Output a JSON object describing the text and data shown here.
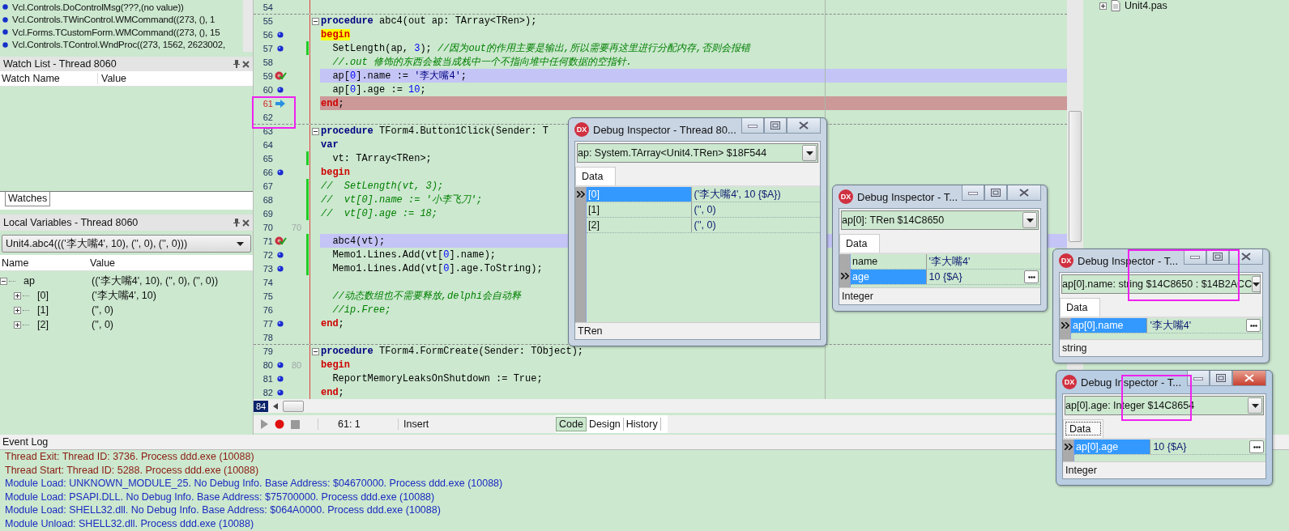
{
  "call_stack": [
    {
      "text": "Vcl.Controls.DoControlMsg(???,(no value))"
    },
    {
      "text": "Vcl.Controls.TWinControl.WMCommand((273, (), 1"
    },
    {
      "text": "Vcl.Forms.TCustomForm.WMCommand((273, (), 15"
    },
    {
      "text": "Vcl.Controls.TControl.WndProc((273, 1562, 2623002,"
    }
  ],
  "watch_list": {
    "title": "Watch List - Thread 8060",
    "columns": [
      "Watch Name",
      "Value"
    ],
    "tabs": [
      {
        "label": "Watches",
        "selected": true
      }
    ]
  },
  "local_variables": {
    "title": "Local Variables - Thread 8060",
    "frame": "Unit4.abc4((('李大嘴4', 10), ('', 0), ('', 0)))",
    "columns": [
      "Name",
      "Value"
    ],
    "rows": [
      {
        "name": "ap",
        "value": "(('李大嘴4', 10), ('', 0), ('', 0))",
        "expanded": true,
        "children": [
          {
            "name": "[0]",
            "value": "('李大嘴4', 10)",
            "expanded": false
          },
          {
            "name": "[1]",
            "value": "('', 0)",
            "expanded": false
          },
          {
            "name": "[2]",
            "value": "('', 0)",
            "expanded": false
          }
        ]
      }
    ]
  },
  "editor": {
    "lines": [
      {
        "n": "54",
        "fold": false,
        "changed": false
      },
      {
        "n": "55",
        "fold": true,
        "changed": false,
        "tokens": [
          {
            "kind": "kw",
            "text": "procedure"
          },
          {
            "kind": "txt",
            "text": " abc4(out ap: TArray<TRen>);"
          }
        ]
      },
      {
        "n": "56",
        "fold": false,
        "changed": false,
        "breakpoint": {
          "kind": "dot"
        },
        "tokens": [
          {
            "kind": "match",
            "text": "begin"
          }
        ]
      },
      {
        "n": "57",
        "fold": false,
        "changed": true,
        "breakpoint": {
          "kind": "dot"
        },
        "tokens": [
          {
            "kind": "txt",
            "text": "  SetLength(ap, "
          },
          {
            "kind": "num",
            "text": "3"
          },
          {
            "kind": "txt",
            "text": "); "
          },
          {
            "kind": "com",
            "text": "//因为out的作用主要是输出,所以需要再这里进行分配内存,否则会报错"
          }
        ]
      },
      {
        "n": "58",
        "fold": false,
        "changed": false,
        "tokens": [
          {
            "kind": "com",
            "text": "  //.out 修饰的东西会被当成栈中一个不指向堆中任何数据的空指针."
          }
        ]
      },
      {
        "n": "59",
        "fold": false,
        "changed": false,
        "breakpoint": {
          "kind": "verified"
        },
        "highlight": {
          "kind": "exec"
        },
        "tokens": [
          {
            "kind": "txt",
            "text": "  ap["
          },
          {
            "kind": "num",
            "text": "0"
          },
          {
            "kind": "txt",
            "text": "].name := "
          },
          {
            "kind": "str",
            "text": "'李大嘴4'"
          },
          {
            "kind": "txt",
            "text": ";"
          }
        ]
      },
      {
        "n": "60",
        "fold": false,
        "changed": false,
        "breakpoint": {
          "kind": "dot"
        },
        "tokens": [
          {
            "kind": "txt",
            "text": "  ap["
          },
          {
            "kind": "num",
            "text": "0"
          },
          {
            "kind": "txt",
            "text": "].age := "
          },
          {
            "kind": "num",
            "text": "10"
          },
          {
            "kind": "txt",
            "text": ";"
          }
        ]
      },
      {
        "n": "61",
        "fold": false,
        "changed": false,
        "breakpoint": {
          "kind": "arrow"
        },
        "highlight": {
          "kind": "error"
        },
        "tokens": [
          {
            "kind": "blk",
            "text": "end"
          },
          {
            "kind": "txt",
            "text": ";"
          }
        ]
      },
      {
        "n": "62",
        "fold": false,
        "changed": false
      },
      {
        "n": "63",
        "fold": true,
        "changed": false,
        "tokens": [
          {
            "kind": "kw",
            "text": "procedure"
          },
          {
            "kind": "txt",
            "text": " TForm4.Button1Click(Sender: T"
          }
        ]
      },
      {
        "n": "64",
        "fold": false,
        "changed": false,
        "tokens": [
          {
            "kind": "kw",
            "text": "var"
          }
        ]
      },
      {
        "n": "65",
        "fold": false,
        "changed": true,
        "tokens": [
          {
            "kind": "txt",
            "text": "  vt: TArray<TRen>;"
          }
        ]
      },
      {
        "n": "66",
        "fold": false,
        "changed": false,
        "breakpoint": {
          "kind": "dot"
        },
        "tokens": [
          {
            "kind": "blk",
            "text": "begin"
          }
        ]
      },
      {
        "n": "67",
        "fold": false,
        "changed": true,
        "tokens": [
          {
            "kind": "com",
            "text": "//  SetLength(vt, 3);"
          }
        ]
      },
      {
        "n": "68",
        "fold": false,
        "changed": true,
        "tokens": [
          {
            "kind": "com",
            "text": "//  vt[0].name := '小李飞刀';"
          }
        ]
      },
      {
        "n": "69",
        "fold": false,
        "changed": true,
        "tokens": [
          {
            "kind": "com",
            "text": "//  vt[0].age := 18;"
          }
        ]
      },
      {
        "n": "70",
        "fold": false,
        "changed": false,
        "label": "70"
      },
      {
        "n": "71",
        "fold": false,
        "changed": true,
        "breakpoint": {
          "kind": "verified"
        },
        "highlight": {
          "kind": "exec"
        },
        "tokens": [
          {
            "kind": "txt",
            "text": "  abc4(vt);"
          }
        ]
      },
      {
        "n": "72",
        "fold": false,
        "changed": true,
        "breakpoint": {
          "kind": "dot"
        },
        "tokens": [
          {
            "kind": "txt",
            "text": "  Memo1.Lines.Add(vt["
          },
          {
            "kind": "num",
            "text": "0"
          },
          {
            "kind": "txt",
            "text": "].name);"
          }
        ]
      },
      {
        "n": "73",
        "fold": false,
        "changed": true,
        "breakpoint": {
          "kind": "dot"
        },
        "tokens": [
          {
            "kind": "txt",
            "text": "  Memo1.Lines.Add(vt["
          },
          {
            "kind": "num",
            "text": "0"
          },
          {
            "kind": "txt",
            "text": "].age.ToString);"
          }
        ]
      },
      {
        "n": "74",
        "fold": false,
        "changed": false
      },
      {
        "n": "75",
        "fold": false,
        "changed": false,
        "tokens": [
          {
            "kind": "com",
            "text": "  //动态数组也不需要释放,delphi会自动释"
          }
        ]
      },
      {
        "n": "76",
        "fold": false,
        "changed": false,
        "tokens": [
          {
            "kind": "com",
            "text": "  //ip.Free;"
          }
        ]
      },
      {
        "n": "77",
        "fold": false,
        "changed": false,
        "breakpoint": {
          "kind": "dot"
        },
        "tokens": [
          {
            "kind": "blk",
            "text": "end"
          },
          {
            "kind": "txt",
            "text": ";"
          }
        ]
      },
      {
        "n": "78",
        "fold": false,
        "changed": false
      },
      {
        "n": "79",
        "fold": true,
        "changed": false,
        "tokens": [
          {
            "kind": "kw",
            "text": "procedure"
          },
          {
            "kind": "txt",
            "text": " TForm4.FormCreate(Sender: TObject);"
          }
        ]
      },
      {
        "n": "80",
        "fold": false,
        "changed": false,
        "breakpoint": {
          "kind": "dot"
        },
        "label": "80",
        "tokens": [
          {
            "kind": "blk",
            "text": "begin"
          }
        ]
      },
      {
        "n": "81",
        "fold": false,
        "changed": false,
        "breakpoint": {
          "kind": "dot"
        },
        "tokens": [
          {
            "kind": "txt",
            "text": "  ReportMemoryLeaksOnShutdown := True;"
          }
        ]
      },
      {
        "n": "82",
        "fold": false,
        "changed": false,
        "breakpoint": {
          "kind": "dot"
        },
        "tokens": [
          {
            "kind": "blk",
            "text": "end"
          },
          {
            "kind": "txt",
            "text": ";"
          }
        ]
      }
    ],
    "bottom_line_number": "84",
    "status": {
      "position": "61:  1",
      "mode": "Insert"
    },
    "view_tabs": [
      {
        "label": "Code",
        "selected": true
      },
      {
        "label": "Design",
        "selected": false
      },
      {
        "label": "History",
        "selected": false
      }
    ]
  },
  "project_tree": {
    "items": [
      {
        "label": "Unit4.pas"
      }
    ]
  },
  "inspectors": [
    {
      "logo": "DX",
      "title": "Debug Inspector - Thread 80...",
      "active": false,
      "expression": "ap: System.TArray<Unit4.TRen> $18F544",
      "tabs": [
        {
          "label": "Data",
          "selected": true,
          "focused": false
        }
      ],
      "rows": [
        {
          "name": "[0]",
          "value": "('李大嘴4', 10 {$A})",
          "selected": true,
          "edit_button": false
        },
        {
          "name": "[1]",
          "value": "('', 0)",
          "selected": false,
          "edit_button": false
        },
        {
          "name": "[2]",
          "value": "('', 0)",
          "selected": false,
          "edit_button": false
        }
      ],
      "type": "TRen"
    },
    {
      "logo": "DX",
      "title": "Debug Inspector - T...",
      "active": false,
      "expression": "ap[0]: TRen $14C8650",
      "tabs": [
        {
          "label": "Data",
          "selected": true,
          "focused": false
        }
      ],
      "rows": [
        {
          "name": "name",
          "value": "'李大嘴4'",
          "selected": false,
          "edit_button": false
        },
        {
          "name": "age",
          "value": "10 {$A}",
          "selected": true,
          "edit_button": true
        }
      ],
      "type": "Integer"
    },
    {
      "logo": "DX",
      "title": "Debug Inspector - T...",
      "active": false,
      "expression": "ap[0].name: string $14C8650 : $14B2ACC",
      "tabs": [
        {
          "label": "Data",
          "selected": true,
          "focused": false
        }
      ],
      "rows": [
        {
          "name": "ap[0].name",
          "value": "'李大嘴4'",
          "selected": true,
          "edit_button": true
        }
      ],
      "type": "string"
    },
    {
      "logo": "DX",
      "title": "Debug Inspector - T...",
      "active": true,
      "expression": "ap[0].age: Integer $14C8654",
      "tabs": [
        {
          "label": "Data",
          "selected": true,
          "focused": true
        }
      ],
      "rows": [
        {
          "name": "ap[0].age",
          "value": "10 {$A}",
          "selected": true,
          "edit_button": true
        }
      ],
      "type": "Integer"
    }
  ],
  "event_log": {
    "title": "Event Log",
    "entries": [
      {
        "kind": "thread",
        "text": "Thread Exit: Thread ID: 3736. Process ddd.exe (10088)"
      },
      {
        "kind": "thread",
        "text": "Thread Start: Thread ID: 5288. Process ddd.exe (10088)"
      },
      {
        "kind": "module",
        "text": "Module Load: UNKNOWN_MODULE_25. No Debug Info. Base Address: $04670000. Process ddd.exe (10088)"
      },
      {
        "kind": "module",
        "text": "Module Load: PSAPI.DLL. No Debug Info. Base Address: $75700000. Process ddd.exe (10088)"
      },
      {
        "kind": "module",
        "text": "Module Load: SHELL32.dll. No Debug Info. Base Address: $064A0000. Process ddd.exe (10088)"
      },
      {
        "kind": "module",
        "text": "Module Unload: SHELL32.dll. Process ddd.exe (10088)"
      }
    ]
  }
}
